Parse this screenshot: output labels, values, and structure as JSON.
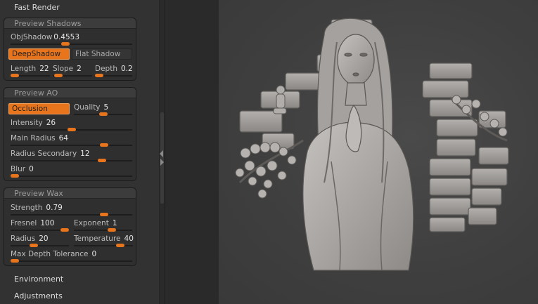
{
  "menu": {
    "fast_render": "Fast Render",
    "environment": "Environment",
    "adjustments": "Adjustments"
  },
  "preview_shadows": {
    "title": "Preview Shadows",
    "obj_shadow": {
      "label": "ObjShadow",
      "value": "0.4553",
      "fraction": 0.45
    },
    "deep_shadow": "DeepShadow",
    "flat_shadow": "Flat Shadow",
    "length": {
      "label": "Length",
      "value": "22",
      "fraction": 0.1
    },
    "slope": {
      "label": "Slope",
      "value": "2",
      "fraction": 0.15
    },
    "depth": {
      "label": "Depth",
      "value": "0.2",
      "fraction": 0.1
    }
  },
  "preview_ao": {
    "title": "Preview AO",
    "occlusion": "Occlusion",
    "quality": {
      "label": "Quality",
      "value": "5",
      "fraction": 0.5
    },
    "intensity": {
      "label": "Intensity",
      "value": "26",
      "fraction": 0.5
    },
    "main_radius": {
      "label": "Main Radius",
      "value": "64",
      "fraction": 0.77
    },
    "radius_secondary": {
      "label": "Radius Secondary",
      "value": "12",
      "fraction": 0.75
    },
    "blur": {
      "label": "Blur",
      "value": "0",
      "fraction": 0.02
    }
  },
  "preview_wax": {
    "title": "Preview Wax",
    "strength": {
      "label": "Strength",
      "value": "0.79",
      "fraction": 0.77
    },
    "fresnel": {
      "label": "Fresnel",
      "value": "100",
      "fraction": 0.93
    },
    "exponent": {
      "label": "Exponent",
      "value": "1",
      "fraction": 0.65
    },
    "radius": {
      "label": "Radius",
      "value": "20",
      "fraction": 0.4
    },
    "temperature": {
      "label": "Temperature",
      "value": "40",
      "fraction": 0.78
    },
    "max_depth_tolerance": {
      "label": "Max Depth Tolerance",
      "value": "0",
      "fraction": 0.02
    }
  },
  "colors": {
    "accent": "#e8751c",
    "panel": "#323232",
    "viewport": "#3f3f3f",
    "sculpt": "#a9a6a3"
  },
  "viewport": {
    "subject": "sculpted relief of a girl with long hair in front of a brick wall with cotton plant branches"
  }
}
